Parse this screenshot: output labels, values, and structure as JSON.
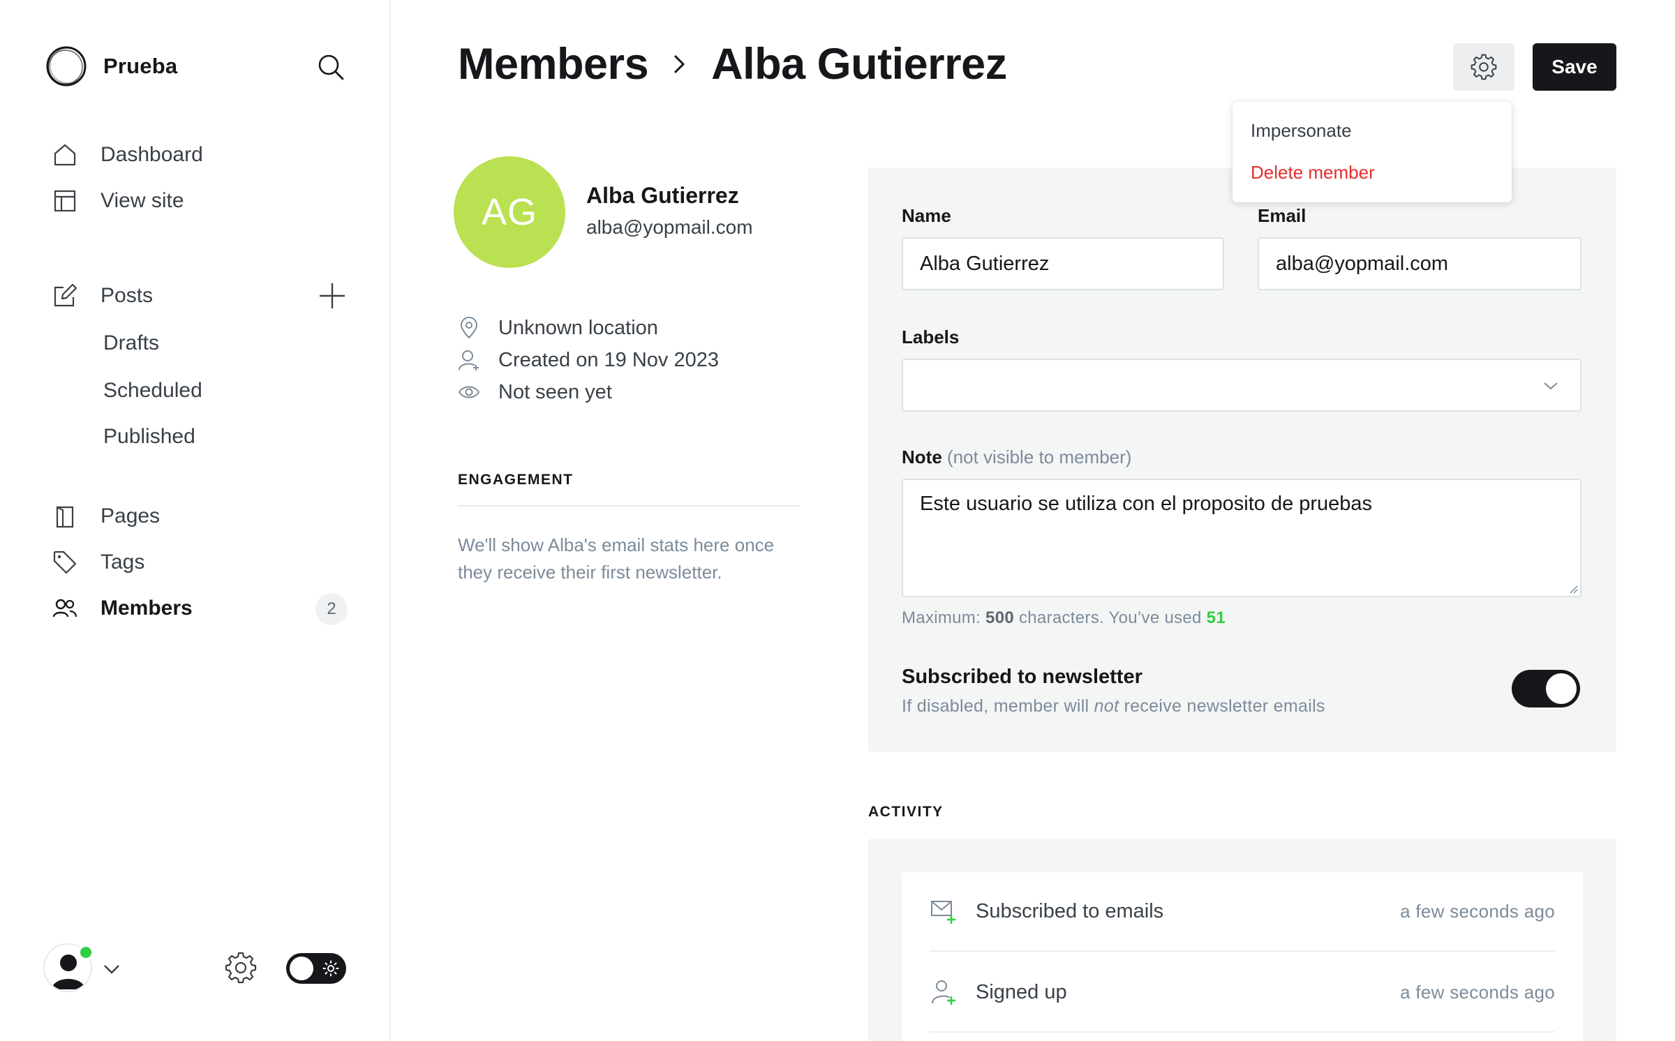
{
  "sidebar": {
    "brand": "Prueba",
    "nav": {
      "dashboard": "Dashboard",
      "view_site": "View site",
      "posts": "Posts",
      "drafts": "Drafts",
      "scheduled": "Scheduled",
      "published": "Published",
      "pages": "Pages",
      "tags": "Tags",
      "members": "Members",
      "members_count": "2"
    },
    "icons": [
      "search-icon",
      "home-icon",
      "layout-icon",
      "edit-icon",
      "plus-icon",
      "page-icon",
      "tag-icon",
      "members-icon",
      "user-avatar-icon",
      "chevron-down-icon",
      "gear-icon",
      "sun-icon"
    ]
  },
  "header": {
    "breadcrumb_parent": "Members",
    "breadcrumb_current": "Alba Gutierrez",
    "save_label": "Save"
  },
  "actions_menu": {
    "impersonate": "Impersonate",
    "delete": "Delete member"
  },
  "profile": {
    "initials": "AG",
    "name": "Alba Gutierrez",
    "email": "alba@yopmail.com",
    "location": "Unknown location",
    "created": "Created on 19 Nov 2023",
    "last_seen": "Not seen yet",
    "avatar_color": "#b9e151"
  },
  "engagement": {
    "heading": "ENGAGEMENT",
    "text": "We'll show Alba's email stats here once they receive their first newsletter."
  },
  "form": {
    "name_label": "Name",
    "name_value": "Alba Gutierrez",
    "email_label": "Email",
    "email_value": "alba@yopmail.com",
    "labels_label": "Labels",
    "labels_value": "",
    "note_label": "Note",
    "note_sublabel": "(not visible to member)",
    "note_value": "Este usuario se utiliza con el proposito de pruebas",
    "hint_prefix": "Maximum: ",
    "hint_max": "500",
    "hint_middle": " characters. You’ve used ",
    "hint_used": "51",
    "newsletter_title": "Subscribed to newsletter",
    "newsletter_desc_pre": "If disabled, member will ",
    "newsletter_desc_em": "not",
    "newsletter_desc_post": " receive newsletter emails",
    "newsletter_enabled": true
  },
  "activity": {
    "heading": "ACTIVITY",
    "items": [
      {
        "label": "Subscribed to emails",
        "time": "a few seconds ago",
        "icon": "email-subscribe-icon"
      },
      {
        "label": "Signed up",
        "time": "a few seconds ago",
        "icon": "user-add-icon"
      }
    ]
  },
  "colors": {
    "accent_green": "#30cf43",
    "danger": "#e52e2e",
    "dark": "#15171a"
  }
}
